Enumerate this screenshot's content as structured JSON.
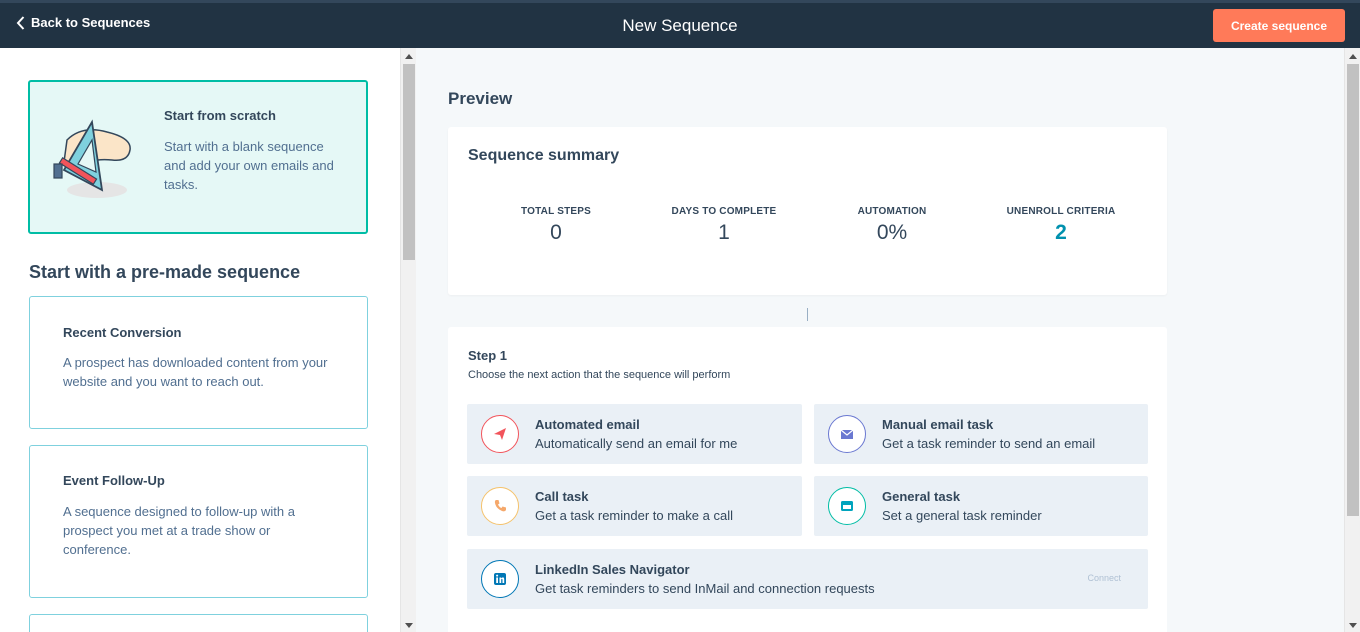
{
  "topbar": {
    "back_label": "Back to Sequences",
    "title": "New Sequence",
    "create_label": "Create sequence"
  },
  "left": {
    "scratch": {
      "heading": "Start from scratch",
      "description": "Start with a blank sequence and add your own emails and tasks."
    },
    "premade_title": "Start with a pre-made sequence",
    "cards": [
      {
        "heading": "Recent Conversion",
        "description": "A prospect has downloaded content from your website and you want to reach out."
      },
      {
        "heading": "Event Follow-Up",
        "description": "A sequence designed to follow-up with a prospect you met at a trade show or conference."
      }
    ]
  },
  "preview": {
    "title": "Preview",
    "summary": {
      "heading": "Sequence summary",
      "stats": [
        {
          "label": "TOTAL STEPS",
          "value": "0"
        },
        {
          "label": "DAYS TO COMPLETE",
          "value": "1"
        },
        {
          "label": "AUTOMATION",
          "value": "0%"
        },
        {
          "label": "UNENROLL CRITERIA",
          "value": "2"
        }
      ]
    },
    "step": {
      "heading": "Step 1",
      "subheading": "Choose the next action that the sequence will perform",
      "options": [
        {
          "heading": "Automated email",
          "description": "Automatically send an email for me",
          "icon": "send-icon",
          "color": "#f2545b"
        },
        {
          "heading": "Manual email task",
          "description": "Get a task reminder to send an email",
          "icon": "envelope-icon",
          "color": "#6a78d1"
        },
        {
          "heading": "Call task",
          "description": "Get a task reminder to make a call",
          "icon": "phone-icon",
          "color": "#f5c26b"
        },
        {
          "heading": "General task",
          "description": "Set a general task reminder",
          "icon": "task-icon",
          "color": "#00bda5"
        },
        {
          "heading": "LinkedIn Sales Navigator",
          "description": "Get task reminders to send InMail and connection requests",
          "icon": "linkedin-icon",
          "color": "#0077b5",
          "action": "Connect"
        }
      ]
    }
  }
}
